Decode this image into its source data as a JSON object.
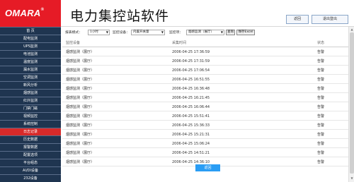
{
  "header": {
    "logo_text": "OMARA",
    "logo_mark": "®",
    "title": "电力集控站软件",
    "back_label": "返回",
    "logout_label": "退出登出"
  },
  "sidebar": {
    "items": [
      {
        "label": "首 页",
        "active": false
      },
      {
        "label": "配电监测",
        "active": false
      },
      {
        "label": "UPS监测",
        "active": false
      },
      {
        "label": "电池监测",
        "active": false
      },
      {
        "label": "温度监测",
        "active": false
      },
      {
        "label": "漏水监测",
        "active": false
      },
      {
        "label": "空调监测",
        "active": false
      },
      {
        "label": "新风分析",
        "active": false
      },
      {
        "label": "烟感监测",
        "active": false
      },
      {
        "label": "红外监测",
        "active": false
      },
      {
        "label": "门禁门磁",
        "active": false
      },
      {
        "label": "视频监控",
        "active": false
      },
      {
        "label": "系统控制",
        "active": false
      },
      {
        "label": "日志记录",
        "active": true
      },
      {
        "label": "历史数据",
        "active": false
      },
      {
        "label": "报警数据",
        "active": false
      },
      {
        "label": "配置选项",
        "active": false
      },
      {
        "label": "平台组态",
        "active": false
      },
      {
        "label": "AI/DI设备",
        "active": false
      },
      {
        "label": "232设备",
        "active": false
      }
    ]
  },
  "toolbar": {
    "mode_label": "报表模式：",
    "mode_value": "1小时",
    "device_label": "监控设备：",
    "device_value": "内置开关量",
    "group_label": "监控项：",
    "group_value": "烟感监测（展厅）",
    "query_label": "查询",
    "export_label": "保存Excel"
  },
  "table": {
    "columns": [
      "监控设备",
      "采集时间",
      "状态"
    ],
    "rows": [
      [
        "烟感监测（展厅）",
        "2006-04-25 17:36:59",
        "告警"
      ],
      [
        "烟感监测（展厅）",
        "2006-04-25 17:31:59",
        "告警"
      ],
      [
        "烟感监测（展厅）",
        "2006-04-25 17:06:54",
        "告警"
      ],
      [
        "烟感监测（展厅）",
        "2006-04-25 16:51:55",
        "告警"
      ],
      [
        "烟感监测（展厅）",
        "2006-04-25 16:36:48",
        "告警"
      ],
      [
        "烟感监测（展厅）",
        "2006-04-25 16:21:45",
        "告警"
      ],
      [
        "烟感监测（展厅）",
        "2006-04-25 16:06:44",
        "告警"
      ],
      [
        "烟感监测（展厅）",
        "2006-04-25 15:51:41",
        "告警"
      ],
      [
        "烟感监测（展厅）",
        "2006-04-25 15:36:33",
        "告警"
      ],
      [
        "烟感监测（展厅）",
        "2006-04-25 15:21:31",
        "告警"
      ],
      [
        "烟感监测（展厅）",
        "2006-04-25 15:06:24",
        "告警"
      ],
      [
        "烟感监测（展厅）",
        "2006-04-25 14:51:21",
        "告警"
      ],
      [
        "烟感监测（展厅）",
        "2006-04-25 14:36:10",
        "告警"
      ]
    ]
  },
  "confirm_label": "返回",
  "colors": {
    "logo_red": "#e61b26",
    "nav_bg": "#1f3550",
    "nav_active": "#d72a2a",
    "accent_blue": "#2a9df4"
  }
}
